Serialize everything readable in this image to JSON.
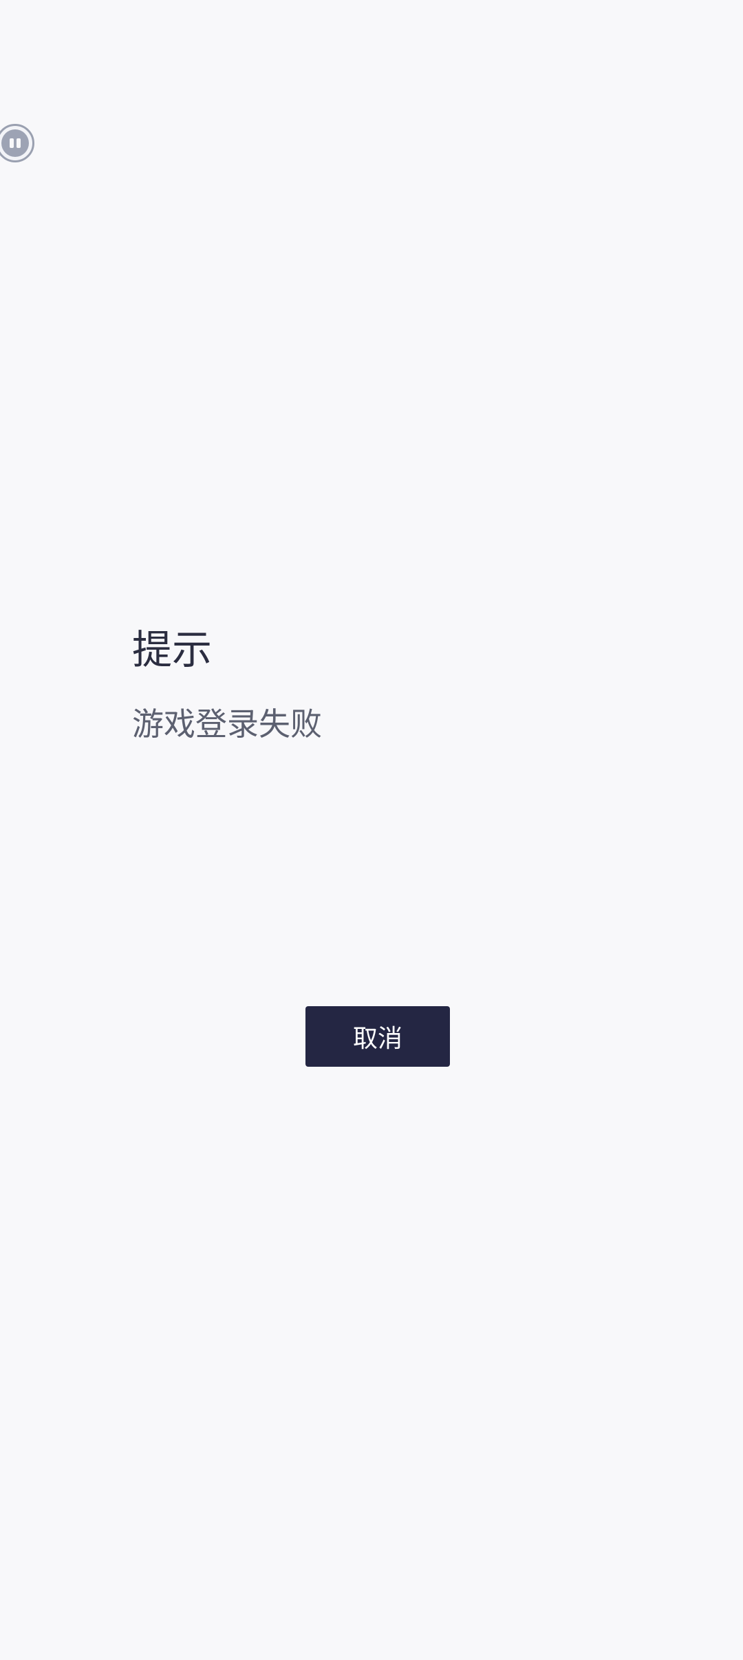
{
  "floating_ball": {
    "icon": "pause-icon"
  },
  "dialog": {
    "title": "提示",
    "message": "游戏登录失败",
    "cancel_label": "取消"
  },
  "colors": {
    "background": "#f8f8fa",
    "button": "#242643",
    "button_text": "#ffffff",
    "title_text": "#2b2d40",
    "message_text": "#5c6070"
  }
}
